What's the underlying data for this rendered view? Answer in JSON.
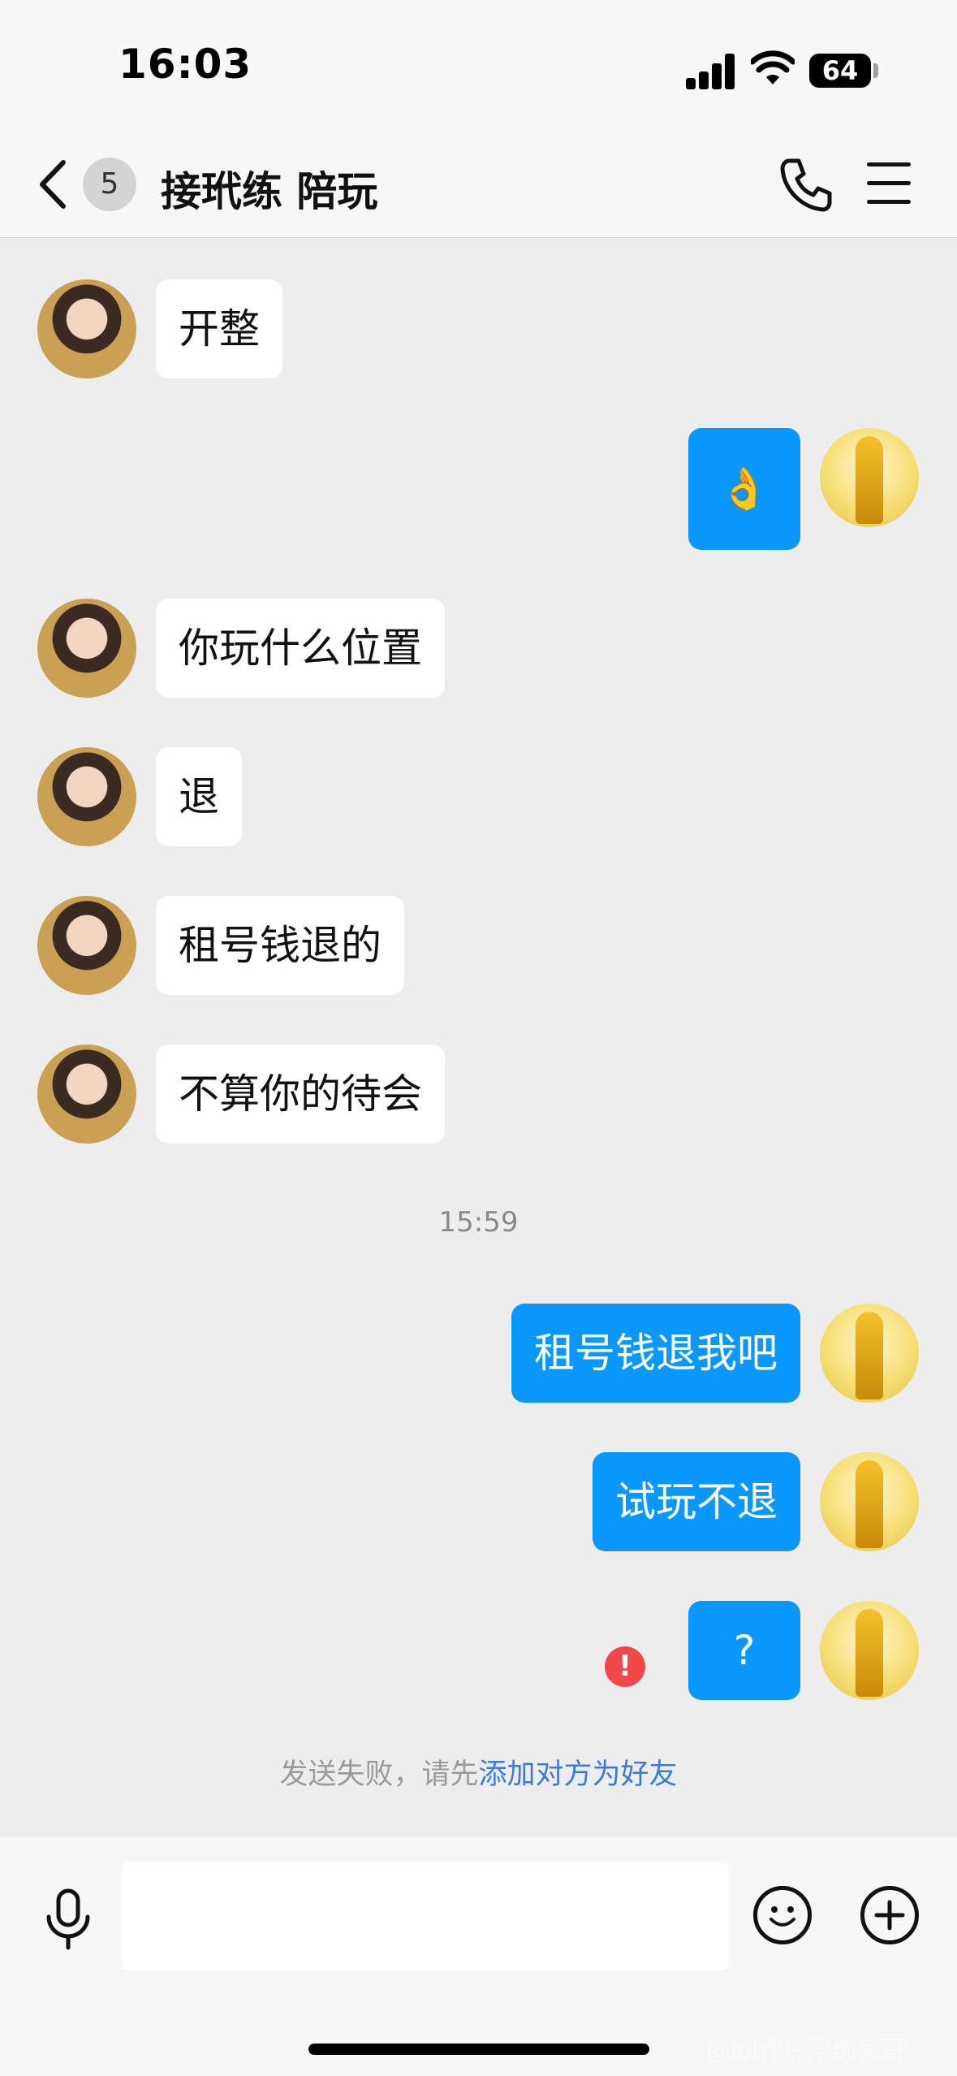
{
  "status_bar": {
    "time": "16:03",
    "battery": "64"
  },
  "header": {
    "back_badge": "5",
    "title": "接玳练 陪玩"
  },
  "messages": [
    {
      "text": "开整",
      "direction": "in"
    },
    {
      "text": "👌",
      "direction": "out"
    },
    {
      "text": "你玩什么位置",
      "direction": "in"
    },
    {
      "text": "退",
      "direction": "in"
    },
    {
      "text": "租号钱退的",
      "direction": "in"
    },
    {
      "text": "不算你的待会",
      "direction": "in"
    },
    {
      "text": "租号钱退我吧",
      "direction": "out"
    },
    {
      "text": "试玩不退",
      "direction": "out"
    },
    {
      "text": "?",
      "direction": "out",
      "failed": true
    }
  ],
  "timestamp": "15:59",
  "failed_notice": {
    "prefix": "发送失败，请先",
    "link": "添加对方为好友"
  },
  "error_mark": "!",
  "watermark": "@lol代练陪练表哥",
  "colors": {
    "outgoing_bubble": "#0a98ff",
    "incoming_bubble": "#ffffff",
    "error": "#f04848",
    "link": "#3c7bd8"
  }
}
